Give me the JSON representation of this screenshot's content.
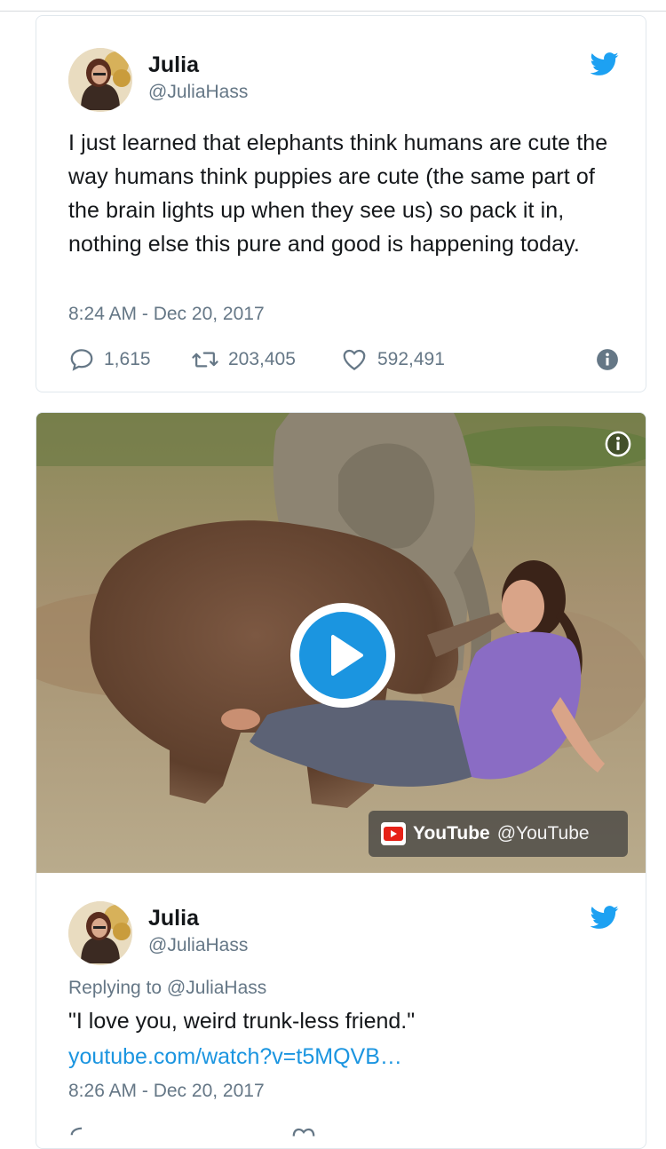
{
  "tweet": {
    "author_name": "Julia",
    "author_handle": "@JuliaHass",
    "text": "I just learned that elephants think humans are cute the way humans think puppies are cute (the same part of the brain lights up when they see us) so pack it in, nothing else this pure and good is happening today.",
    "timestamp": "8:24 AM - Dec 20, 2017",
    "replies": "1,615",
    "retweets": "203,405",
    "likes": "592,491"
  },
  "embed": {
    "video_source_name": "YouTube",
    "video_source_handle": "@YouTube"
  },
  "reply_tweet": {
    "author_name": "Julia",
    "author_handle": "@JuliaHass",
    "replying_prefix": "Replying to ",
    "replying_to": "@JuliaHass",
    "text": "\"I love you, weird trunk-less friend.\"",
    "link": "youtube.com/watch?v=t5MQVB…",
    "timestamp": "8:26 AM - Dec 20, 2017"
  },
  "colors": {
    "twitter_blue": "#1b95e0",
    "muted_text": "#657786",
    "like_red": "#e0245e",
    "youtube_red": "#e62117"
  },
  "icons": [
    "twitter-bird-icon",
    "reply-icon",
    "retweet-icon",
    "heart-icon",
    "info-icon",
    "play-icon",
    "youtube-logo-icon"
  ]
}
